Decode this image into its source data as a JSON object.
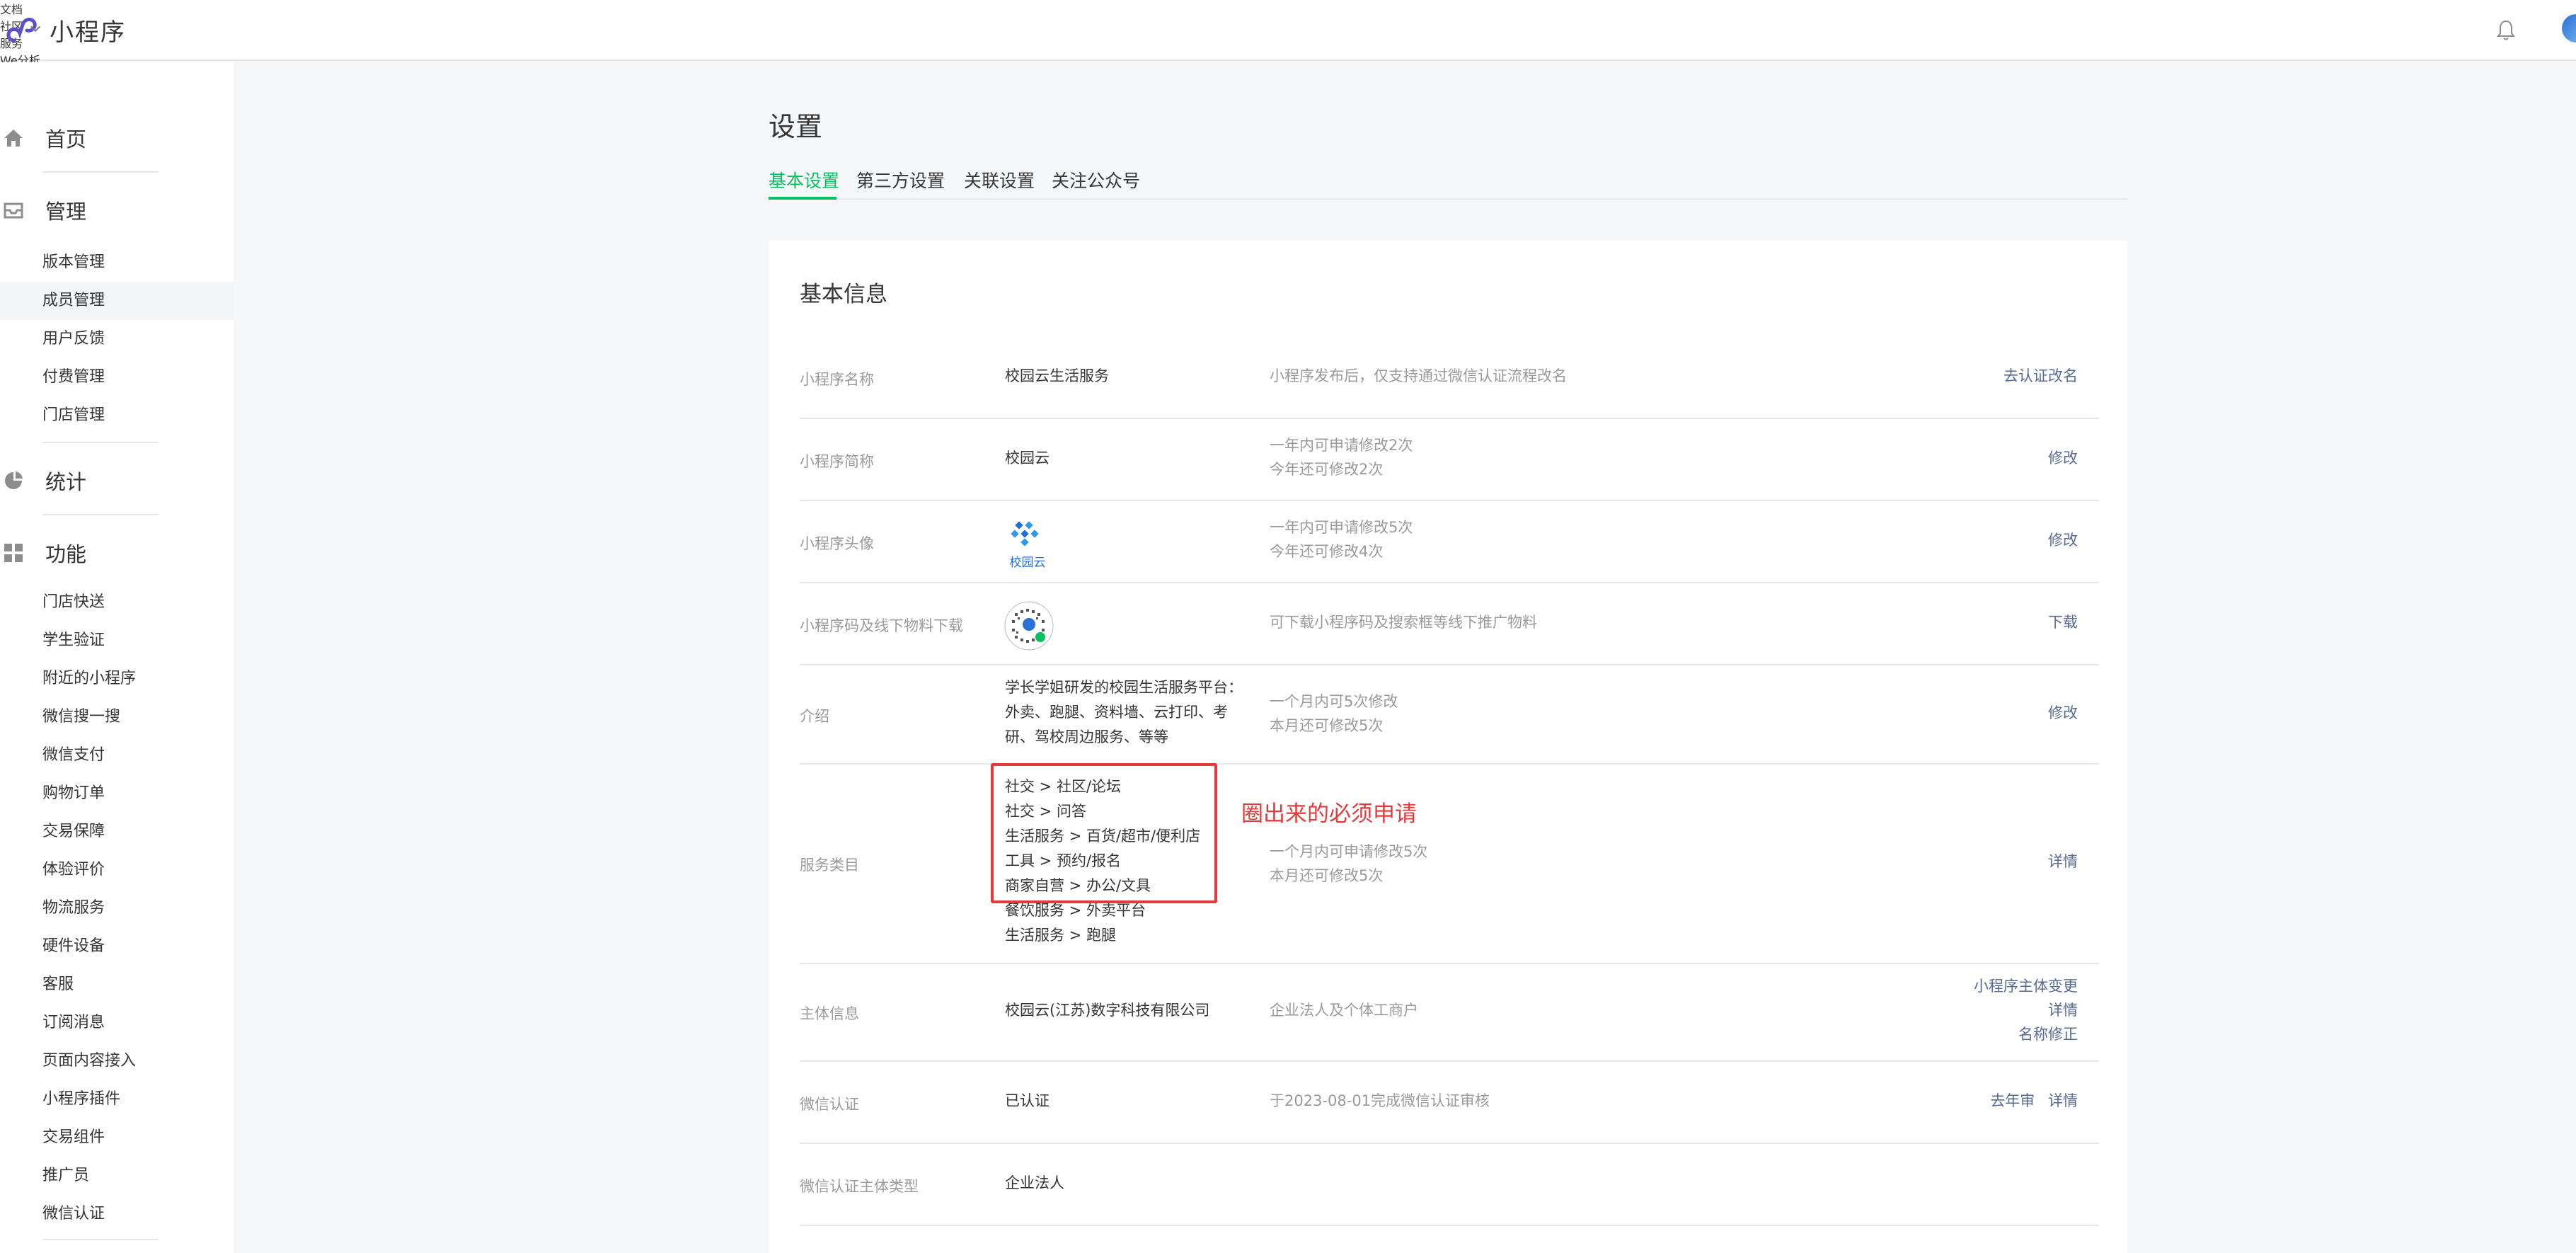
{
  "app": {
    "title": "小程序"
  },
  "topnav": {
    "docs": "文档",
    "community": "社区",
    "service": "服务",
    "analytics": "We分析",
    "tools": "工具"
  },
  "sidebar": {
    "home": "首页",
    "manage": "管理",
    "manage_items": [
      "版本管理",
      "成员管理",
      "用户反馈",
      "付费管理",
      "门店管理"
    ],
    "stats": "统计",
    "features": "功能",
    "feature_items": [
      "门店快送",
      "学生验证",
      "附近的小程序",
      "微信搜一搜",
      "微信支付",
      "购物订单",
      "交易保障",
      "体验评价",
      "物流服务",
      "硬件设备",
      "客服",
      "订阅消息",
      "页面内容接入",
      "小程序插件",
      "交易组件",
      "推广员",
      "微信认证"
    ]
  },
  "page": {
    "title": "设置",
    "tabs": [
      "基本设置",
      "第三方设置",
      "关联设置",
      "关注公众号"
    ]
  },
  "card": {
    "title": "基本信息",
    "rows": {
      "name": {
        "label": "小程序名称",
        "value": "校园云生活服务",
        "desc": "小程序发布后，仅支持通过微信认证流程改名",
        "action": "去认证改名"
      },
      "short": {
        "label": "小程序简称",
        "value": "校园云",
        "desc1": "一年内可申请修改2次",
        "desc2": "今年还可修改2次",
        "action": "修改"
      },
      "avatar": {
        "label": "小程序头像",
        "logo_text": "校园云",
        "desc1": "一年内可申请修改5次",
        "desc2": "今年还可修改4次",
        "action": "修改"
      },
      "qrcode": {
        "label": "小程序码及线下物料下载",
        "desc": "可下载小程序码及搜索框等线下推广物料",
        "action": "下载"
      },
      "intro": {
        "label": "介绍",
        "lines": [
          "学长学姐研发的校园生活服务平台：",
          "外卖、跑腿、资料墙、云打印、考",
          "研、驾校周边服务、等等"
        ],
        "desc1": "一个月内可5次修改",
        "desc2": "本月还可修改5次",
        "action": "修改"
      },
      "category": {
        "label": "服务类目",
        "lines": [
          "社交 > 社区/论坛",
          "社交 > 问答",
          "生活服务 > 百货/超市/便利店",
          "工具 > 预约/报名",
          "商家自营 > 办公/文具",
          "餐饮服务 > 外卖平台",
          "生活服务 > 跑腿"
        ],
        "desc1": "一个月内可申请修改5次",
        "desc2": "本月还可修改5次",
        "action": "详情"
      },
      "entity": {
        "label": "主体信息",
        "value": "校园云(江苏)数字科技有限公司",
        "desc": "企业法人及个体工商户",
        "actions": [
          "小程序主体变更",
          "详情",
          "名称修正"
        ]
      },
      "verify": {
        "label": "微信认证",
        "value": "已认证",
        "desc": "于2023-08-01完成微信认证审核",
        "actions": [
          "去年审",
          "详情"
        ]
      },
      "verify_type": {
        "label": "微信认证主体类型",
        "value": "企业法人"
      }
    }
  },
  "annotation": {
    "text": "圈出来的必须申请",
    "color": "#e23b3b"
  },
  "colors": {
    "accent": "#07c160",
    "link": "#576b95",
    "brand": "#5a4fcf"
  }
}
